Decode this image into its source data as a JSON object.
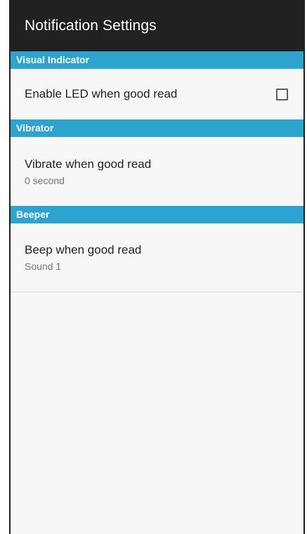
{
  "toolbar": {
    "title": "Notification Settings"
  },
  "sections": [
    {
      "header": "Visual Indicator",
      "items": [
        {
          "title": "Enable LED when good read",
          "checked": false
        }
      ]
    },
    {
      "header": "Vibrator",
      "items": [
        {
          "title": "Vibrate when good read",
          "summary": "0 second"
        }
      ]
    },
    {
      "header": "Beeper",
      "items": [
        {
          "title": "Beep when good read",
          "summary": "Sound 1"
        }
      ]
    }
  ],
  "colors": {
    "toolbar": "#212121",
    "section_header": "#2da3cf",
    "background": "#f7f7f7"
  }
}
